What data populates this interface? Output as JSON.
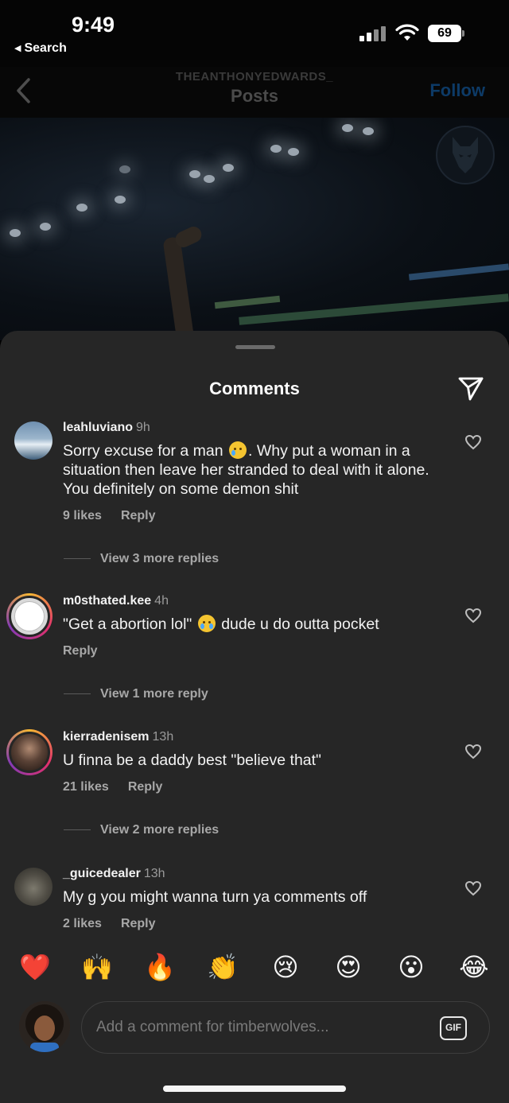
{
  "status_bar": {
    "time": "9:49",
    "back_app": "Search",
    "battery": "69"
  },
  "header": {
    "handle": "THEANTHONYEDWARDS_",
    "title": "Posts",
    "follow_label": "Follow"
  },
  "sheet": {
    "title": "Comments"
  },
  "comments": [
    {
      "username": "leahluviano",
      "time": "9h",
      "text_before": "Sorry excuse for a man",
      "text_after": ". Why put a woman in a situation then leave her stranded to deal with it alone. You definitely on some demon shit",
      "likes": "9 likes",
      "reply": "Reply",
      "view_replies": "View 3 more replies"
    },
    {
      "username": "m0sthated.kee",
      "time": "4h",
      "text_before": "\"Get a abortion lol\"",
      "text_after": "dude u do outta pocket",
      "reply": "Reply",
      "view_replies": "View 1 more reply"
    },
    {
      "username": "kierradenisem",
      "time": "13h",
      "text": "U finna be a daddy best \"believe that\"",
      "likes": "21 likes",
      "reply": "Reply",
      "view_replies": "View 2 more replies"
    },
    {
      "username": "_guicedealer",
      "time": "13h",
      "text": "My g you might wanna turn ya comments off",
      "likes": "2 likes",
      "reply": "Reply"
    }
  ],
  "reactions": [
    "❤️",
    "🙌",
    "🔥",
    "👏",
    "😢",
    "😍",
    "😮",
    "😂"
  ],
  "composer": {
    "placeholder": "Add a comment for timberwolves...",
    "gif_label": "GIF"
  }
}
